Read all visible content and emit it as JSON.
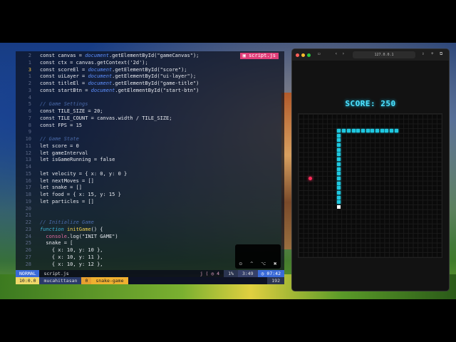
{
  "editor": {
    "tab_label": "script.js",
    "code": [
      {
        "n": "2",
        "t": [
          [
            "kw",
            "const canvas = "
          ],
          [
            "blue",
            "document"
          ],
          [
            "kw",
            ".getElementById(\"gameCanvas\");"
          ]
        ]
      },
      {
        "n": "1",
        "t": [
          [
            "kw",
            "const ctx = canvas.getContext('2d');"
          ]
        ]
      },
      {
        "n": "3",
        "cur": true,
        "t": [
          [
            "kw",
            "const scoreEl = "
          ],
          [
            "blue",
            "document"
          ],
          [
            "kw",
            ".getElementById(\"score\");"
          ]
        ]
      },
      {
        "n": "1",
        "t": [
          [
            "kw",
            "const uiLayer = "
          ],
          [
            "blue",
            "document"
          ],
          [
            "kw",
            ".getElementById(\"ui-layer\");"
          ]
        ]
      },
      {
        "n": "2",
        "t": [
          [
            "kw",
            "const titleEl = "
          ],
          [
            "blue",
            "document"
          ],
          [
            "kw",
            ".getElementById(\"game-title\")"
          ]
        ]
      },
      {
        "n": "3",
        "t": [
          [
            "kw",
            "const startBtn = "
          ],
          [
            "blue",
            "document"
          ],
          [
            "kw",
            ".getElementById(\"start-btn\")"
          ]
        ]
      },
      {
        "n": "4",
        "t": []
      },
      {
        "n": "5",
        "t": [
          [
            "com",
            "// Game Settings"
          ]
        ]
      },
      {
        "n": "6",
        "t": [
          [
            "kw",
            "const TILE_SIZE = 20;"
          ]
        ]
      },
      {
        "n": "7",
        "t": [
          [
            "kw",
            "const TILE_COUNT = canvas.width / TILE_SIZE;"
          ]
        ]
      },
      {
        "n": "8",
        "t": [
          [
            "kw",
            "const FPS = 15"
          ]
        ]
      },
      {
        "n": "9",
        "t": []
      },
      {
        "n": "10",
        "t": [
          [
            "com",
            "// Game State"
          ]
        ]
      },
      {
        "n": "11",
        "t": [
          [
            "kw",
            "let score = 0"
          ]
        ]
      },
      {
        "n": "12",
        "t": [
          [
            "kw",
            "let gameInterval"
          ]
        ]
      },
      {
        "n": "13",
        "t": [
          [
            "kw",
            "let isGameRunning = false"
          ]
        ]
      },
      {
        "n": "14",
        "t": []
      },
      {
        "n": "15",
        "t": [
          [
            "kw",
            "let velocity = { x: 0, y: 0 }"
          ]
        ]
      },
      {
        "n": "16",
        "t": [
          [
            "kw",
            "let nextMoves = []"
          ]
        ]
      },
      {
        "n": "17",
        "t": [
          [
            "kw",
            "let snake = []"
          ]
        ]
      },
      {
        "n": "18",
        "t": [
          [
            "kw",
            "let food = { x: 15, y: 15 }"
          ]
        ]
      },
      {
        "n": "19",
        "t": [
          [
            "kw",
            "let particles = []"
          ]
        ]
      },
      {
        "n": "20",
        "t": []
      },
      {
        "n": "21",
        "t": []
      },
      {
        "n": "22",
        "t": [
          [
            "com",
            "// Initialize Game"
          ]
        ]
      },
      {
        "n": "23",
        "t": [
          [
            "fn",
            "function "
          ],
          [
            "yel",
            "initGame"
          ],
          [
            "kw",
            "() {"
          ]
        ]
      },
      {
        "n": "24",
        "t": [
          [
            "pink",
            "  console"
          ],
          [
            "kw",
            ".log(\"INIT GAME\")"
          ]
        ]
      },
      {
        "n": "25",
        "t": [
          [
            "kw",
            "  snake = ["
          ]
        ]
      },
      {
        "n": "26",
        "t": [
          [
            "kw",
            "    { x: 10, y: 10 },"
          ]
        ]
      },
      {
        "n": "27",
        "t": [
          [
            "kw",
            "    { x: 10, y: 11 },"
          ]
        ]
      },
      {
        "n": "28",
        "t": [
          [
            "kw",
            "    { x: 10, y: 12 },"
          ]
        ]
      }
    ],
    "popup_icons": [
      "⊙",
      "^",
      "⌥",
      "✖"
    ]
  },
  "statusline": {
    "mode": "NORMAL",
    "file": "script.js",
    "misc": "j ⟨ ◎ 4",
    "percent": "1%",
    "position": "3:49",
    "clock": "◷ 07:42"
  },
  "tmux": {
    "session": "10:0.0",
    "user": "mucahittasan",
    "window": "0",
    "name": "snake-game",
    "count": "192"
  },
  "browser": {
    "address": "127.0.0.1",
    "score_text": "SCORE: 250",
    "colors": {
      "snake": "#1ec8e0",
      "food": "#ff2a5a",
      "score": "#4fe3ff"
    }
  },
  "game": {
    "grid": 30,
    "snake": [
      [
        20,
        3
      ],
      [
        19,
        3
      ],
      [
        18,
        3
      ],
      [
        17,
        3
      ],
      [
        16,
        3
      ],
      [
        15,
        3
      ],
      [
        14,
        3
      ],
      [
        13,
        3
      ],
      [
        12,
        3
      ],
      [
        11,
        3
      ],
      [
        10,
        3
      ],
      [
        9,
        3
      ],
      [
        8,
        3
      ],
      [
        8,
        4
      ],
      [
        8,
        5
      ],
      [
        8,
        6
      ],
      [
        8,
        7
      ],
      [
        8,
        8
      ],
      [
        8,
        9
      ],
      [
        8,
        10
      ],
      [
        8,
        11
      ],
      [
        8,
        12
      ],
      [
        8,
        13
      ],
      [
        8,
        14
      ],
      [
        8,
        15
      ],
      [
        8,
        16
      ],
      [
        8,
        17
      ],
      [
        8,
        18
      ]
    ],
    "head": [
      8,
      19
    ],
    "food": [
      2,
      13
    ]
  }
}
